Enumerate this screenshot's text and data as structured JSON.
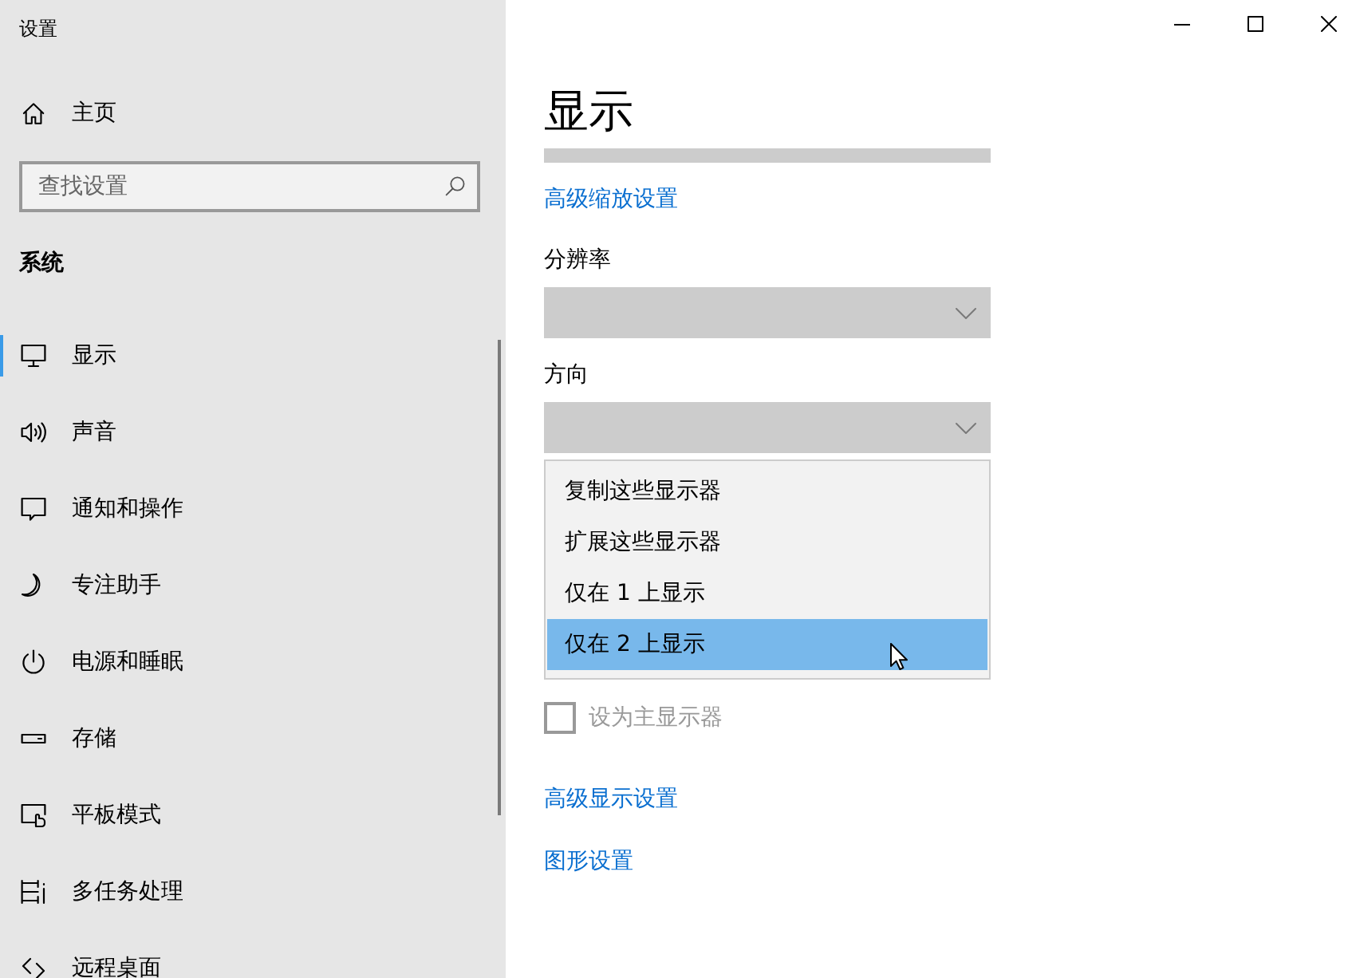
{
  "window": {
    "title": "设置"
  },
  "sidebar": {
    "home": "主页",
    "search": {
      "placeholder": "查找设置"
    },
    "section": "系统",
    "items": [
      {
        "label": "显示",
        "selected": true
      },
      {
        "label": "声音",
        "selected": false
      },
      {
        "label": "通知和操作",
        "selected": false
      },
      {
        "label": "专注助手",
        "selected": false
      },
      {
        "label": "电源和睡眠",
        "selected": false
      },
      {
        "label": "存储",
        "selected": false
      },
      {
        "label": "平板模式",
        "selected": false
      },
      {
        "label": "多任务处理",
        "selected": false
      },
      {
        "label": "远程桌面",
        "selected": false
      }
    ]
  },
  "content": {
    "title": "显示",
    "scale_link": "高级缩放设置",
    "dropdowns": [
      {
        "label": "分辨率",
        "expanded": false
      },
      {
        "label": "方向",
        "expanded": true,
        "options": [
          {
            "label": "复制这些显示器",
            "selected": false
          },
          {
            "label": "扩展这些显示器",
            "selected": false
          },
          {
            "label": "仅在 1 上显示",
            "selected": false
          },
          {
            "label": "仅在 2 上显示",
            "selected": true
          }
        ]
      }
    ],
    "main_display": {
      "label": "设为主显示器",
      "checked": false,
      "disabled": true
    },
    "links": [
      "高级显示设置",
      "图形设置"
    ]
  }
}
